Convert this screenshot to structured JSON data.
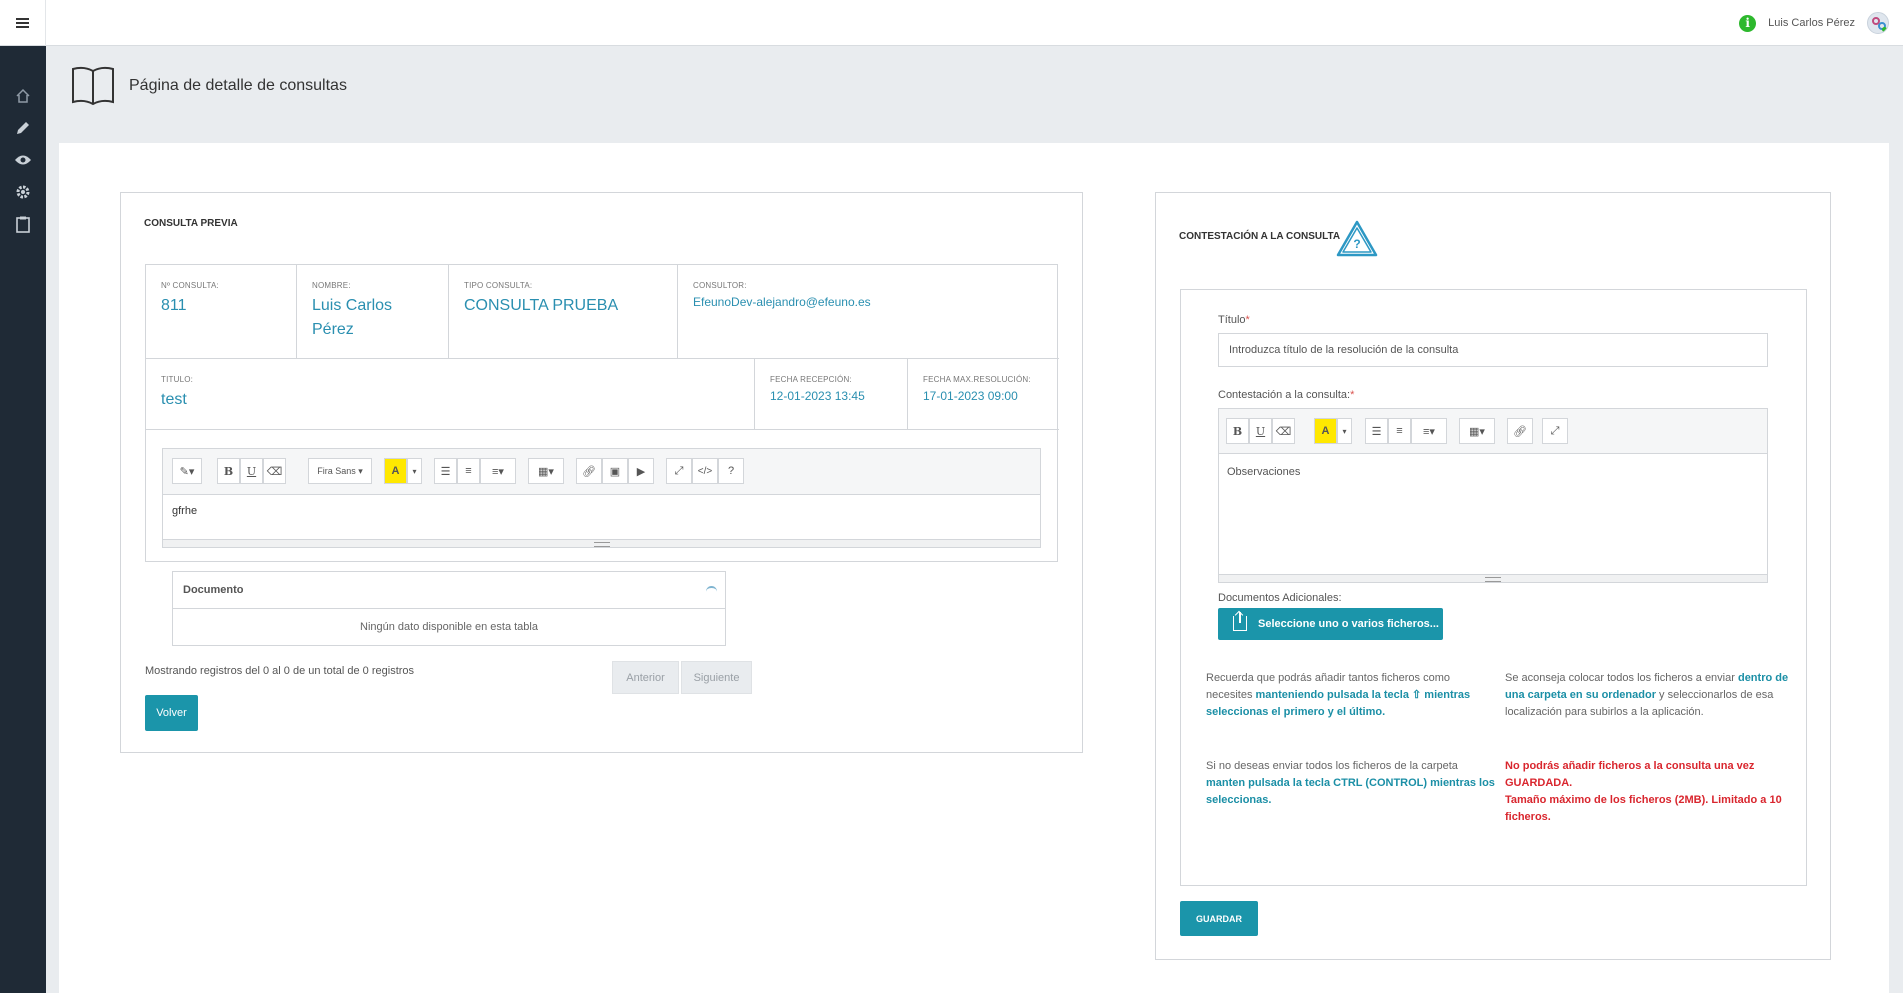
{
  "topbar": {
    "user_name": "Luis Carlos Pérez",
    "info_icon": "info-icon",
    "avatar_icon": "user-avatar"
  },
  "sidebar": {
    "items": [
      {
        "icon": "home-icon"
      },
      {
        "icon": "pencil-icon"
      },
      {
        "icon": "eye-icon"
      },
      {
        "icon": "gear-icon"
      },
      {
        "icon": "clipboard-icon"
      }
    ]
  },
  "page": {
    "title": "Página de detalle de consultas"
  },
  "consulta_previa": {
    "section_title": "CONSULTA PREVIA",
    "num_label": "Nº CONSULTA:",
    "num_value": "811",
    "nombre_label": "NOMBRE:",
    "nombre_value": "Luis Carlos Pérez",
    "tipo_label": "TIPO CONSULTA:",
    "tipo_value": "CONSULTA PRUEBA",
    "consultor_label": "CONSULTOR:",
    "consultor_value": "EfeunoDev-alejandro@efeuno.es",
    "titulo_label": "TITULO:",
    "titulo_value": "test",
    "fecha_recepcion_label": "FECHA RECEPCIÓN:",
    "fecha_recepcion_value": "12-01-2023 13:45",
    "fecha_max_label": "FECHA MAX.RESOLUCIÓN:",
    "fecha_max_value": "17-01-2023 09:00",
    "editor_font": "Fira Sans",
    "editor_content": "gfrhe"
  },
  "documentos": {
    "column_header": "Documento",
    "empty_message": "Ningún dato disponible en esta tabla",
    "showing_text": "Mostrando registros del 0 al 0 de un total de 0 registros",
    "prev_label": "Anterior",
    "next_label": "Siguiente"
  },
  "volver_label": "Volver",
  "contestacion": {
    "section_title": "CONTESTACIÓN A LA CONSULTA",
    "titulo_label": "Título",
    "titulo_placeholder": "Introduzca título de la resolución de la consulta",
    "contestacion_label": "Contestación a la consulta:",
    "editor_placeholder": "Observaciones",
    "docs_label": "Documentos Adicionales:",
    "files_button": "Seleccione uno o varios ficheros...",
    "note1_a": "Recuerda que podrás añadir tantos ficheros como necesites ",
    "note1_b": "manteniendo pulsada la tecla ⇧ mientras seleccionas el primero y el último.",
    "note2_a": "Se aconseja colocar todos los ficheros a enviar ",
    "note2_b": "dentro de una carpeta en su ordenador",
    "note2_c": " y seleccionarlos de esa localización para subirlos a la aplicación.",
    "note3_a": "Si no deseas enviar todos los ficheros de la carpeta ",
    "note3_b": "manten pulsada la tecla CTRL (CONTROL) mientras los seleccionas.",
    "note4_a": "No podrás añadir ficheros a la consulta una vez GUARDADA.",
    "note4_b": "Tamaño máximo de los ficheros (2MB). Limitado a 10 ficheros.",
    "save_label": "GUARDAR"
  }
}
